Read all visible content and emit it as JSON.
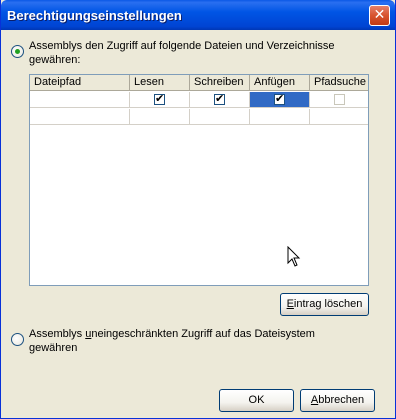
{
  "window": {
    "title": "Berechtigungseinstellungen",
    "close_glyph": "✕"
  },
  "option_restricted": {
    "checked": true,
    "line1": "Assemblys den Zugriff auf folgende Dateien und Verzeichnisse",
    "line2": "gewähren:"
  },
  "grid": {
    "columns": [
      "Dateipfad",
      "Lesen",
      "Schreiben",
      "Anfügen",
      "Pfadsuche"
    ],
    "rows": [
      {
        "path": "",
        "lesen": true,
        "schreiben": true,
        "anfuegen": true,
        "pfadsuche": false
      }
    ]
  },
  "buttons": {
    "delete_entry_prefix": "E",
    "delete_entry_rest": "intrag löschen",
    "ok": "OK",
    "cancel_prefix": "A",
    "cancel_rest": "bbrechen"
  },
  "option_unrestricted": {
    "checked": false,
    "line1_a": "Assemblys ",
    "line1_b": "u",
    "line1_c": "neingeschränkten Zugriff auf das Dateisystem",
    "line2": "gewähren"
  },
  "icons": {
    "check_glyph": "✔",
    "close": "close-icon",
    "cursor": "mouse-cursor-icon"
  }
}
